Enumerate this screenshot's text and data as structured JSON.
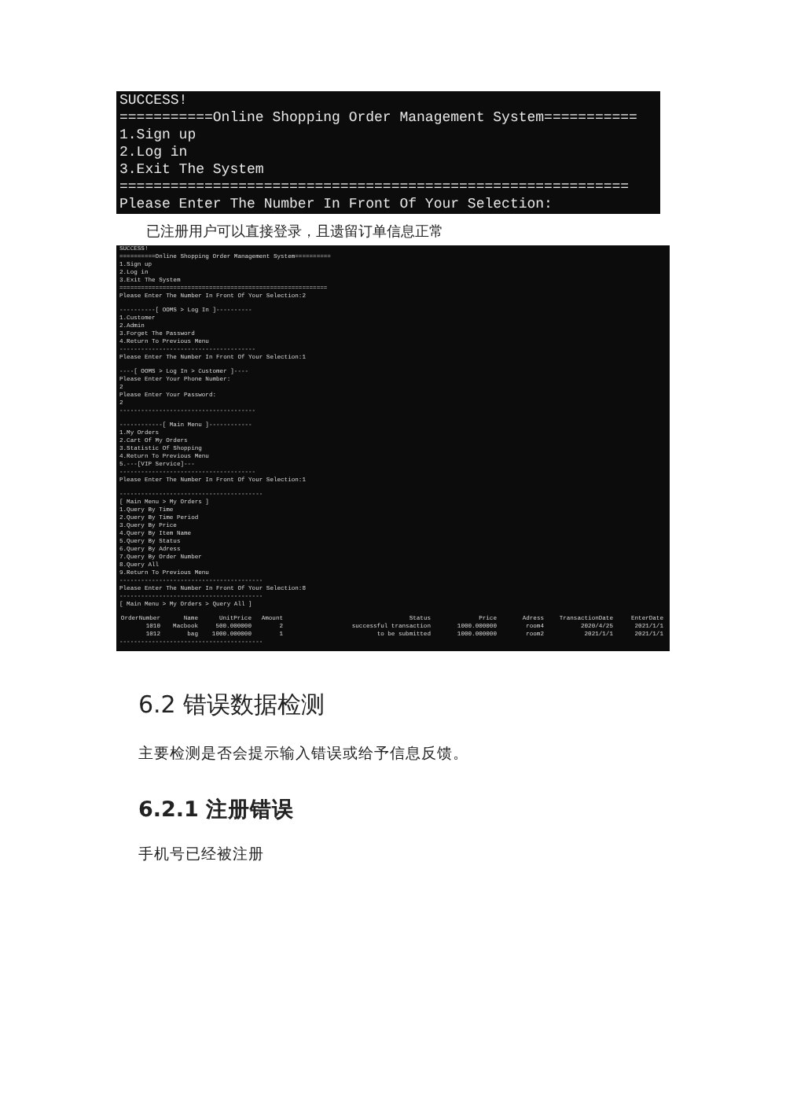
{
  "console_1": {
    "lines": [
      "SUCCESS!",
      "===========Online Shopping Order Management System===========",
      "1.Sign up",
      "2.Log in",
      "3.Exit The System",
      "============================================================",
      "Please Enter The Number In Front Of Your Selection:"
    ]
  },
  "caption": "已注册用户可以直接登录，且遗留订单信息正常",
  "console_2": {
    "blocks": [
      [
        "SUCCESS!",
        "==========Online Shopping Order Management System==========",
        "1.Sign up",
        "2.Log in",
        "3.Exit The System",
        "==========================================================",
        "Please Enter The Number In Front Of Your Selection:2"
      ],
      [
        "----------[ OOMS > Log In ]----------",
        "1.Customer",
        "2.Admin",
        "3.Forget The Password",
        "4.Return To Previous Menu",
        "--------------------------------------",
        "Please Enter The Number In Front Of Your Selection:1"
      ],
      [
        "----[ OOMS > Log In > Customer ]----",
        "Please Enter Your Phone Number:",
        "2",
        "Please Enter Your Password:",
        "2",
        "--------------------------------------"
      ],
      [
        "------------[ Main Menu ]------------",
        "1.My Orders",
        "2.Cart Of My Orders",
        "3.Statistic Of Shopping",
        "4.Return To Previous Menu",
        "5.---[VIP Service]---",
        "--------------------------------------",
        "Please Enter The Number In Front Of Your Selection:1"
      ],
      [
        "----------------------------------------",
        "[ Main Menu > My Orders ]",
        "1.Query By Time",
        "2.Query By Time Period",
        "3.Query By Price",
        "4.Query By Item Name",
        "5.Query By Status",
        "6.Query By Adress",
        "7.Query By Order Number",
        "8.Query All",
        "9.Return To Previous Menu",
        "----------------------------------------",
        "Please Enter The Number In Front Of Your Selection:8",
        "----------------------------------------",
        "[ Main Menu > My Orders > Query All ]"
      ]
    ],
    "table": {
      "columns": [
        "OrderNumber",
        "Name",
        "UnitPrice",
        "Amount",
        "Status",
        "Price",
        "Adress",
        "TransactionDate",
        "EnterDate"
      ],
      "rows": [
        [
          "1010",
          "Macbook",
          "500.000000",
          "2",
          "successful transaction",
          "1000.000000",
          "room4",
          "2020/4/25",
          "2021/1/1"
        ],
        [
          "1012",
          "bag",
          "1000.000000",
          "1",
          "to be submitted",
          "1000.000000",
          "room2",
          "2021/1/1",
          "2021/1/1"
        ]
      ]
    },
    "footer_line": "----------------------------------------"
  },
  "heading": "6.2  错误数据检测",
  "paragraph": "主要检测是否会提示输入错误或给予信息反馈。",
  "subheading": "6.2.1 注册错误",
  "paragraph_2": "手机号已经被注册"
}
